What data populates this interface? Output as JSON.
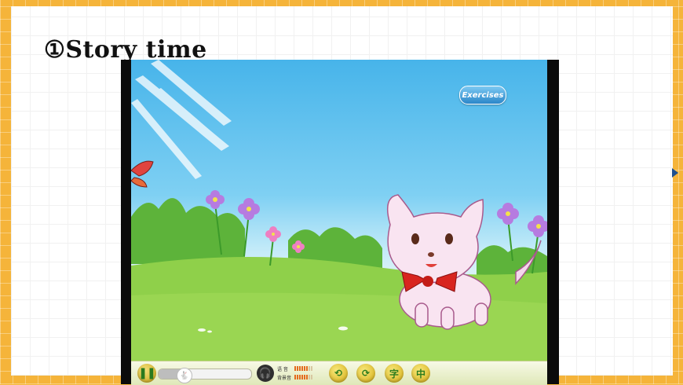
{
  "slide": {
    "title": "①Story time"
  },
  "player": {
    "exercises_label": "Exercises",
    "progress": 0.28,
    "controls": {
      "voice_label": "语 音",
      "bgm_label": "背景音",
      "char_button": "字",
      "chinese_button": "中"
    }
  },
  "colors": {
    "frame": "#f5b43a",
    "sky": "#47b4ea",
    "grass": "#8fd04a"
  },
  "icons": [
    "pause-icon",
    "bunny-thumb-icon",
    "headphones-icon",
    "back-arrow-icon",
    "forward-arrow-icon"
  ]
}
